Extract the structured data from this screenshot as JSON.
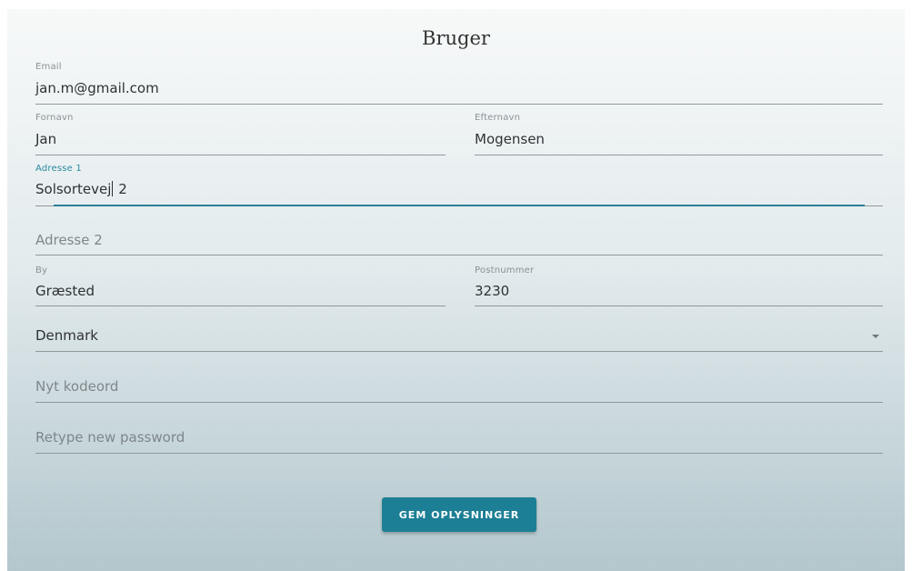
{
  "form": {
    "title": "Bruger",
    "email": {
      "label": "Email",
      "value": "jan.m@gmail.com"
    },
    "first_name": {
      "label": "Fornavn",
      "value": "Jan"
    },
    "last_name": {
      "label": "Efternavn",
      "value": "Mogensen"
    },
    "address1": {
      "label": "Adresse 1",
      "value_before_caret": "Solsortevej",
      "value_after_caret": " 2"
    },
    "address2": {
      "placeholder": "Adresse 2"
    },
    "city": {
      "label": "By",
      "value": "Græsted"
    },
    "postal_code": {
      "label": "Postnummer",
      "value": "3230"
    },
    "country": {
      "value": "Denmark"
    },
    "new_password": {
      "placeholder": "Nyt kodeord"
    },
    "retype_password": {
      "placeholder": "Retype new password"
    },
    "save_label": "GEM OPLYSNINGER"
  },
  "colors": {
    "accent": "#1d7f95",
    "focus_label": "#2b8aa0"
  }
}
